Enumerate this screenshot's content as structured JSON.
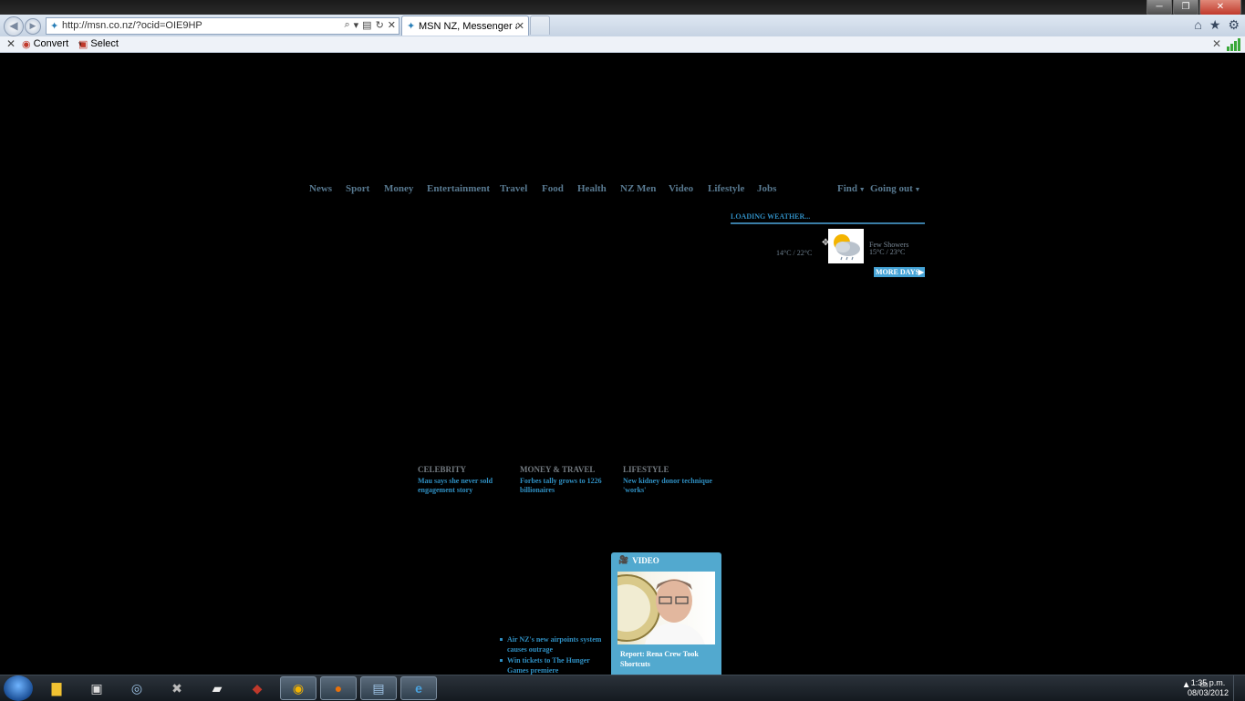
{
  "browser": {
    "url": "http://msn.co.nz/?ocid=OIE9HP",
    "tab_title": "MSN NZ, Messenger and h...",
    "window_controls": [
      "─",
      "❐",
      "✕"
    ],
    "toolbar_icons": [
      "home-icon",
      "star-icon",
      "gear-icon"
    ]
  },
  "command_bar": {
    "convert_label": "Convert",
    "select_label": "Select"
  },
  "nav": {
    "items": [
      "News",
      "Sport",
      "Money",
      "Entertainment",
      "Travel",
      "Food",
      "Health",
      "NZ Men",
      "Video",
      "Lifestyle",
      "Jobs"
    ],
    "right": [
      "Find",
      "Going out"
    ]
  },
  "weather": {
    "heading": "LOADING WEATHER...",
    "today_temp": "14°C / 22°C",
    "condition": "Few Showers",
    "forecast_temp": "15°C / 23°C",
    "more_label": "MORE DAYS"
  },
  "columns": [
    {
      "title": "CELEBRITY",
      "link": "Mau says she never sold engagement story"
    },
    {
      "title": "MONEY & TRAVEL",
      "link": "Forbes tally grows to 1226 billionaires"
    },
    {
      "title": "LIFESTYLE",
      "link": "New kidney donor technique 'works'"
    }
  ],
  "bullets": [
    "Air NZ's new airpoints system causes outrage",
    "Win tickets to The Hunger Games premiere"
  ],
  "video": {
    "label": "VIDEO",
    "caption": "Report: Rena Crew Took Shortcuts"
  },
  "taskbar": {
    "time": "1:35 p.m.",
    "date": "08/03/2012"
  },
  "colors": {
    "nav_link": "#587990",
    "accent_blue": "#2f8fc2",
    "video_bg": "#52a9cf"
  }
}
